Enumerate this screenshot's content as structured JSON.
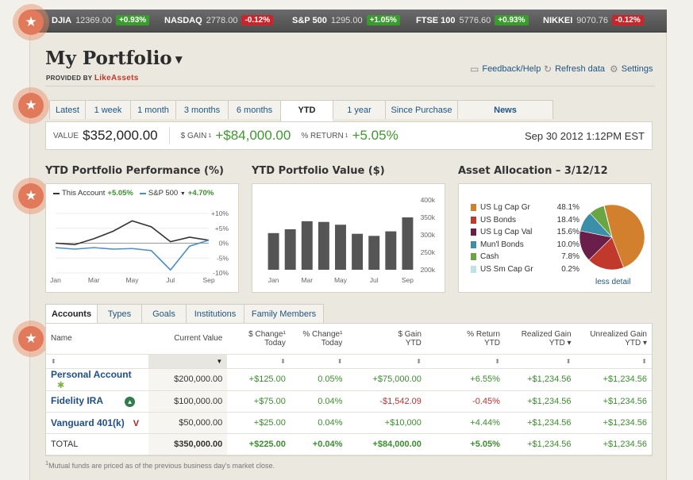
{
  "ticker": [
    {
      "symbol": "DJIA",
      "value": "12369.00",
      "change": "+0.93%",
      "dir": "up"
    },
    {
      "symbol": "NASDAQ",
      "value": "2778.00",
      "change": "-0.12%",
      "dir": "down"
    },
    {
      "symbol": "S&P 500",
      "value": "1295.00",
      "change": "+1.05%",
      "dir": "up"
    },
    {
      "symbol": "FTSE 100",
      "value": "5776.60",
      "change": "+0.93%",
      "dir": "up"
    },
    {
      "symbol": "NIKKEI",
      "value": "9070.76",
      "change": "-0.12%",
      "dir": "down"
    }
  ],
  "header": {
    "title": "My Portfolio",
    "provided_by": "PROVIDED BY",
    "brand": "LikeAssets"
  },
  "toplinks": {
    "feedback": "Feedback/Help",
    "refresh": "Refresh data",
    "settings": "Settings"
  },
  "period_tabs": [
    "Latest",
    "1 week",
    "1 month",
    "3 months",
    "6 months",
    "YTD",
    "1 year",
    "Since Purchase",
    "News"
  ],
  "summary": {
    "value_label": "VALUE",
    "value": "$352,000.00",
    "gain_label": "$ GAIN",
    "gain": "+$84,000.00",
    "return_label": "% RETURN",
    "return": "+5.05%",
    "sup": "1",
    "timestamp": "Sep 30 2012 1:12PM EST"
  },
  "sections": {
    "performance": "YTD Portfolio Performance (%)",
    "value": "YTD Portfolio Value ($)",
    "allocation": "Asset Allocation – 3/12/12"
  },
  "performance_legend": {
    "account": "This Account",
    "account_val": "+5.05%",
    "sp": "S&P 500",
    "sp_val": "+4.70%"
  },
  "chart_data": [
    {
      "type": "line",
      "title": "YTD Portfolio Performance (%)",
      "x": [
        "Jan",
        "Feb",
        "Mar",
        "Apr",
        "May",
        "Jun",
        "Jul",
        "Aug",
        "Sep"
      ],
      "x_labels": [
        "Jan",
        "Mar",
        "May",
        "Jul",
        "Sep"
      ],
      "y_ticks": [
        "+10%",
        "+5%",
        "0%",
        "-5%",
        "-10%"
      ],
      "ylim": [
        -10,
        10
      ],
      "series": [
        {
          "name": "This Account",
          "color": "#333333",
          "values": [
            0,
            -0.5,
            1.5,
            4,
            7.5,
            5.5,
            0.5,
            2,
            1
          ]
        },
        {
          "name": "S&P 500",
          "color": "#4a90c8",
          "values": [
            -1.5,
            -2,
            -1.5,
            -2,
            -1.8,
            -2.5,
            -9,
            -1,
            1
          ]
        }
      ]
    },
    {
      "type": "bar",
      "title": "YTD Portfolio Value ($)",
      "categories": [
        "Jan",
        "Feb",
        "Mar",
        "Apr",
        "May",
        "Jun",
        "Jul",
        "Aug",
        "Sep"
      ],
      "x_labels": [
        "Jan",
        "Mar",
        "May",
        "Jul",
        "Sep"
      ],
      "values": [
        305000,
        316000,
        339000,
        337000,
        329000,
        303000,
        297000,
        310000,
        350000
      ],
      "y_ticks": [
        "400k",
        "350k",
        "300k",
        "250k",
        "200k"
      ],
      "ylim": [
        200000,
        400000
      ],
      "color": "#555555"
    },
    {
      "type": "pie",
      "title": "Asset Allocation – 3/12/12",
      "labels": [
        "US Lg Cap Gr",
        "US Bonds",
        "US Lg Cap Val",
        "Mun'l Bonds",
        "Cash",
        "US Sm Cap Gr"
      ],
      "values": [
        48.1,
        18.4,
        15.6,
        10.0,
        7.8,
        0.2
      ],
      "display": [
        "48.1%",
        "18.4%",
        "15.6%",
        "10.0%",
        "7.8%",
        "0.2%"
      ],
      "colors": [
        "#d27f2e",
        "#c0392b",
        "#6b1e4a",
        "#3b8fa8",
        "#6aa544",
        "#bfe0e8"
      ]
    }
  ],
  "less_detail": "less detail",
  "account_tabs": [
    "Accounts",
    "Types",
    "Goals",
    "Institutions",
    "Family Members"
  ],
  "table": {
    "headers": [
      "Name",
      "Current Value",
      "$ Change¹\nToday",
      "% Change¹\nToday",
      "$ Gain\nYTD",
      "% Return\nYTD",
      "Realized Gain\nYTD ▾",
      "Unrealized Gain\nYTD ▾"
    ],
    "rows": [
      {
        "name": "Personal Account",
        "value": "$200,000.00",
        "chg": "+$125.00",
        "pct": "0.05%",
        "gain": "+$75,000.00",
        "ret": "+6.55%",
        "real": "+$1,234.56",
        "unreal": "+$1,234.56",
        "gain_neg": false
      },
      {
        "name": "Fidelity IRA",
        "value": "$100,000.00",
        "chg": "+$75.00",
        "pct": "0.04%",
        "gain": "-$1,542.09",
        "ret": "-0.45%",
        "real": "+$1,234.56",
        "unreal": "+$1,234.56",
        "gain_neg": true
      },
      {
        "name": "Vanguard 401(k)",
        "value": "$50,000.00",
        "chg": "+$25.00",
        "pct": "0.04%",
        "gain": "+$10,000",
        "ret": "+4.44%",
        "real": "+$1,234.56",
        "unreal": "+$1,234.56",
        "gain_neg": false
      }
    ],
    "total": {
      "name": "TOTAL",
      "value": "$350,000.00",
      "chg": "+$225.00",
      "pct": "+0.04%",
      "gain": "+$84,000.00",
      "ret": "+5.05%",
      "real": "+$1,234.56",
      "unreal": "+$1,234.56"
    }
  },
  "footnote": "Mutual funds are priced as of the previous business day's market close.",
  "footnote_sup": "1",
  "accent": "#3a9b2f"
}
